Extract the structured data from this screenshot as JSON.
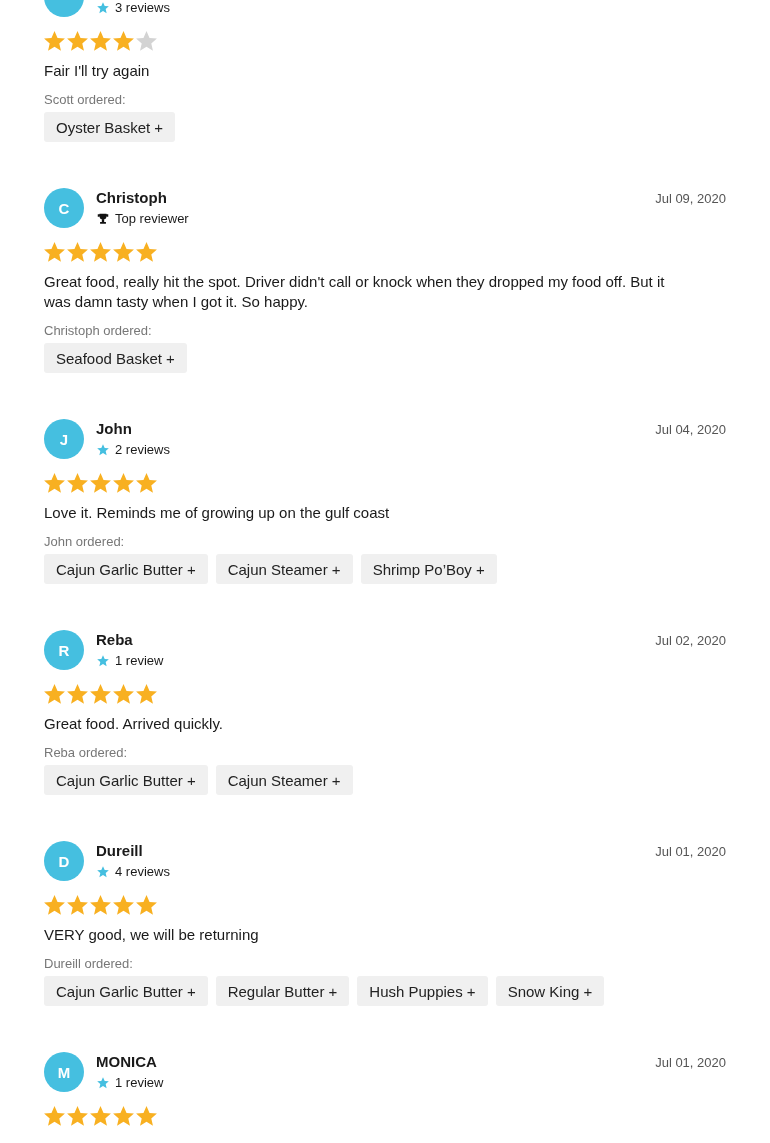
{
  "reviews": [
    {
      "badge": {
        "kind": "reviews",
        "text": "3 reviews"
      },
      "stars": 4,
      "text": "Fair I'll try again",
      "ordered_label": "Scott ordered:",
      "items": [
        "Oyster Basket +"
      ]
    },
    {
      "initial": "C",
      "name": "Christoph",
      "date": "Jul 09, 2020",
      "badge": {
        "kind": "top",
        "text": "Top reviewer"
      },
      "stars": 5,
      "text": "Great food, really hit the spot. Driver didn't call or knock when they dropped my food off. But it was damn tasty when I got it. So happy.",
      "ordered_label": "Christoph ordered:",
      "items": [
        "Seafood Basket +"
      ]
    },
    {
      "initial": "J",
      "name": "John",
      "date": "Jul 04, 2020",
      "badge": {
        "kind": "reviews",
        "text": "2 reviews"
      },
      "stars": 5,
      "text": "Love it. Reminds me of growing up on the gulf coast",
      "ordered_label": "John ordered:",
      "items": [
        "Cajun Garlic Butter +",
        "Cajun Steamer +",
        "Shrimp Po’Boy +"
      ]
    },
    {
      "initial": "R",
      "name": "Reba",
      "date": "Jul 02, 2020",
      "badge": {
        "kind": "reviews",
        "text": "1 review"
      },
      "stars": 5,
      "text": "Great food. Arrived quickly.",
      "ordered_label": "Reba ordered:",
      "items": [
        "Cajun Garlic Butter +",
        "Cajun Steamer +"
      ]
    },
    {
      "initial": "D",
      "name": "Dureill",
      "date": "Jul 01, 2020",
      "badge": {
        "kind": "reviews",
        "text": "4 reviews"
      },
      "stars": 5,
      "text": "VERY good, we will be returning",
      "ordered_label": "Dureill ordered:",
      "items": [
        "Cajun Garlic Butter +",
        "Regular Butter +",
        "Hush Puppies +",
        "Snow King +"
      ]
    },
    {
      "initial": "M",
      "name": "MONICA",
      "date": "Jul 01, 2020",
      "badge": {
        "kind": "reviews",
        "text": "1 review"
      },
      "stars": 5
    }
  ]
}
